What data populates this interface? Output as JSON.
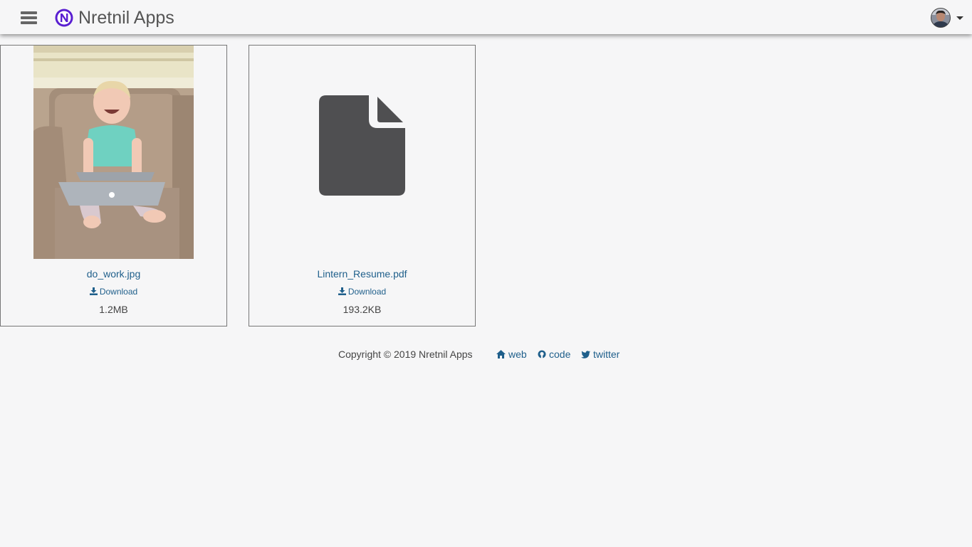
{
  "header": {
    "app_title": "Nretnil Apps",
    "menu_icon": "hamburger-menu-icon",
    "logo_icon": "nretnil-logo-icon",
    "avatar_icon": "user-avatar",
    "accent_color": "#5a1fd1"
  },
  "files": [
    {
      "name": "do_work.jpg",
      "download_label": "Download",
      "size": "1.2MB",
      "preview": "photo-thumbnail"
    },
    {
      "name": "Lintern_Resume.pdf",
      "download_label": "Download",
      "size": "193.2KB",
      "preview": "document-file-icon"
    }
  ],
  "footer": {
    "copyright": "Copyright © 2019 Nretnil Apps",
    "links": [
      {
        "label": "web",
        "icon": "home-icon"
      },
      {
        "label": "code",
        "icon": "github-icon"
      },
      {
        "label": "twitter",
        "icon": "twitter-icon"
      }
    ],
    "link_color": "#1f5f8b"
  }
}
